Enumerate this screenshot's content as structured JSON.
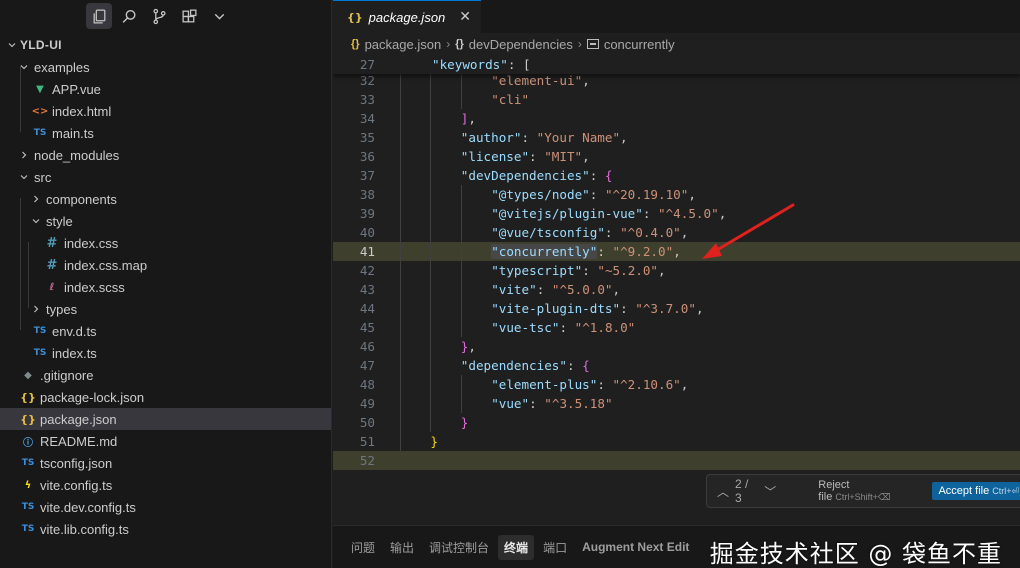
{
  "sidebar": {
    "toolbar_icons": [
      "files-icon",
      "search-icon",
      "source-control-icon",
      "extensions-icon",
      "chevron-down-icon"
    ],
    "tree": [
      {
        "label": "YLD-UI",
        "type": "root",
        "depth": 0,
        "chev": "down"
      },
      {
        "label": "examples",
        "type": "folder",
        "depth": 1,
        "chev": "down"
      },
      {
        "label": "APP.vue",
        "type": "vue",
        "depth": 2
      },
      {
        "label": "index.html",
        "type": "html",
        "depth": 2
      },
      {
        "label": "main.ts",
        "type": "ts",
        "depth": 2
      },
      {
        "label": "node_modules",
        "type": "folder",
        "depth": 1,
        "chev": "right"
      },
      {
        "label": "src",
        "type": "folder",
        "depth": 1,
        "chev": "down"
      },
      {
        "label": "components",
        "type": "folder",
        "depth": 2,
        "chev": "right"
      },
      {
        "label": "style",
        "type": "folder",
        "depth": 2,
        "chev": "down"
      },
      {
        "label": "index.css",
        "type": "css",
        "depth": 3
      },
      {
        "label": "index.css.map",
        "type": "css",
        "depth": 3
      },
      {
        "label": "index.scss",
        "type": "scss",
        "depth": 3
      },
      {
        "label": "types",
        "type": "folder",
        "depth": 2,
        "chev": "right"
      },
      {
        "label": "env.d.ts",
        "type": "ts",
        "depth": 2
      },
      {
        "label": "index.ts",
        "type": "ts",
        "depth": 2
      },
      {
        "label": ".gitignore",
        "type": "git",
        "depth": 1
      },
      {
        "label": "package-lock.json",
        "type": "json",
        "depth": 1
      },
      {
        "label": "package.json",
        "type": "json",
        "depth": 1,
        "selected": true
      },
      {
        "label": "README.md",
        "type": "info",
        "depth": 1
      },
      {
        "label": "tsconfig.json",
        "type": "ts",
        "depth": 1
      },
      {
        "label": "vite.config.ts",
        "type": "bolt",
        "depth": 1
      },
      {
        "label": "vite.dev.config.ts",
        "type": "ts",
        "depth": 1
      },
      {
        "label": "vite.lib.config.ts",
        "type": "ts",
        "depth": 1
      }
    ]
  },
  "editor": {
    "tab": {
      "label": "package.json",
      "icon": "{}",
      "close": "✕"
    },
    "breadcrumb": {
      "file": "package.json",
      "sep": "›",
      "section": "devDependencies",
      "leaf": "concurrently",
      "file_icon": "{}",
      "section_icon": "{}"
    },
    "sticky_line": {
      "number": "27",
      "key": "\"keywords\"",
      "rest": ": ["
    },
    "lines": [
      {
        "n": "32",
        "indent": 3,
        "tokens": [
          [
            "s",
            "\"element-ui\""
          ],
          [
            "p",
            ","
          ]
        ]
      },
      {
        "n": "33",
        "indent": 3,
        "tokens": [
          [
            "s",
            "\"cli\""
          ]
        ]
      },
      {
        "n": "34",
        "indent": 2,
        "tokens": [
          [
            "b1",
            "]"
          ],
          [
            "p",
            ","
          ]
        ]
      },
      {
        "n": "35",
        "indent": 2,
        "tokens": [
          [
            "k",
            "\"author\""
          ],
          [
            "p",
            ": "
          ],
          [
            "s",
            "\"Your Name\""
          ],
          [
            "p",
            ","
          ]
        ]
      },
      {
        "n": "36",
        "indent": 2,
        "tokens": [
          [
            "k",
            "\"license\""
          ],
          [
            "p",
            ": "
          ],
          [
            "s",
            "\"MIT\""
          ],
          [
            "p",
            ","
          ]
        ]
      },
      {
        "n": "37",
        "indent": 2,
        "tokens": [
          [
            "k",
            "\"devDependencies\""
          ],
          [
            "p",
            ": "
          ],
          [
            "b1",
            "{"
          ]
        ]
      },
      {
        "n": "38",
        "indent": 3,
        "tokens": [
          [
            "k",
            "\"@types/node\""
          ],
          [
            "p",
            ": "
          ],
          [
            "s",
            "\"^20.19.10\""
          ],
          [
            "p",
            ","
          ]
        ]
      },
      {
        "n": "39",
        "indent": 3,
        "tokens": [
          [
            "k",
            "\"@vitejs/plugin-vue\""
          ],
          [
            "p",
            ": "
          ],
          [
            "s",
            "\"^4.5.0\""
          ],
          [
            "p",
            ","
          ]
        ]
      },
      {
        "n": "40",
        "indent": 3,
        "tokens": [
          [
            "k",
            "\"@vue/tsconfig\""
          ],
          [
            "p",
            ": "
          ],
          [
            "s",
            "\"^0.4.0\""
          ],
          [
            "p",
            ","
          ]
        ]
      },
      {
        "n": "41",
        "indent": 3,
        "tokens": [
          [
            "kh",
            "\"concurrently\""
          ],
          [
            "p",
            ": "
          ],
          [
            "s",
            "\"^9.2.0\""
          ],
          [
            "p",
            ","
          ]
        ],
        "highlight": true,
        "current": true
      },
      {
        "n": "42",
        "indent": 3,
        "tokens": [
          [
            "k",
            "\"typescript\""
          ],
          [
            "p",
            ": "
          ],
          [
            "s",
            "\"~5.2.0\""
          ],
          [
            "p",
            ","
          ]
        ]
      },
      {
        "n": "43",
        "indent": 3,
        "tokens": [
          [
            "k",
            "\"vite\""
          ],
          [
            "p",
            ": "
          ],
          [
            "s",
            "\"^5.0.0\""
          ],
          [
            "p",
            ","
          ]
        ]
      },
      {
        "n": "44",
        "indent": 3,
        "tokens": [
          [
            "k",
            "\"vite-plugin-dts\""
          ],
          [
            "p",
            ": "
          ],
          [
            "s",
            "\"^3.7.0\""
          ],
          [
            "p",
            ","
          ]
        ]
      },
      {
        "n": "45",
        "indent": 3,
        "tokens": [
          [
            "k",
            "\"vue-tsc\""
          ],
          [
            "p",
            ": "
          ],
          [
            "s",
            "\"^1.8.0\""
          ]
        ]
      },
      {
        "n": "46",
        "indent": 2,
        "tokens": [
          [
            "b1",
            "}"
          ],
          [
            "p",
            ","
          ]
        ]
      },
      {
        "n": "47",
        "indent": 2,
        "tokens": [
          [
            "k",
            "\"dependencies\""
          ],
          [
            "p",
            ": "
          ],
          [
            "b1",
            "{"
          ]
        ]
      },
      {
        "n": "48",
        "indent": 3,
        "tokens": [
          [
            "k",
            "\"element-plus\""
          ],
          [
            "p",
            ": "
          ],
          [
            "s",
            "\"^2.10.6\""
          ],
          [
            "p",
            ","
          ]
        ]
      },
      {
        "n": "49",
        "indent": 3,
        "tokens": [
          [
            "k",
            "\"vue\""
          ],
          [
            "p",
            ": "
          ],
          [
            "s",
            "\"^3.5.18\""
          ]
        ]
      },
      {
        "n": "50",
        "indent": 2,
        "tokens": [
          [
            "b1",
            "}"
          ]
        ]
      },
      {
        "n": "51",
        "indent": 1,
        "tokens": [
          [
            "b2",
            "}"
          ]
        ]
      },
      {
        "n": "52",
        "indent": 0,
        "tokens": [],
        "highlight": true
      }
    ]
  },
  "diff_widget": {
    "counter": "2 / 3",
    "up": "︿",
    "down": "﹀",
    "reject_label": "Reject file",
    "reject_shortcut": "Ctrl+Shift+⌫",
    "accept_label": "Accept file",
    "accept_shortcut": "Ctrl+⏎"
  },
  "panel": {
    "tabs": [
      "问题",
      "输出",
      "调试控制台",
      "终端",
      "端口",
      "Augment Next Edit"
    ],
    "active_tab": "终端",
    "watermark": "掘金技术社区 @ 袋鱼不重"
  },
  "colors": {
    "arrow": "#e0211d",
    "accent": "#0078d4",
    "selection": "#37373d"
  }
}
